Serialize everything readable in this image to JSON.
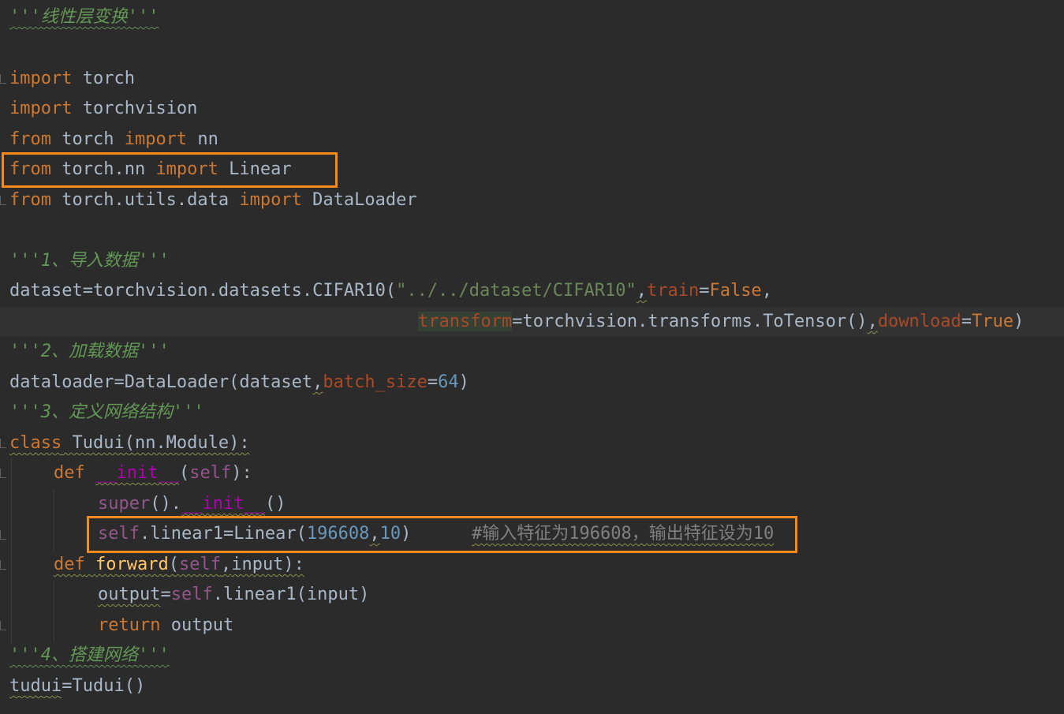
{
  "code": {
    "l1": {
      "doc": "'''线性层变换'''"
    },
    "l3": {
      "kw1": "import",
      "rest": " torch"
    },
    "l4": {
      "kw1": "import",
      "rest": " torchvision"
    },
    "l5": {
      "kw1": "from",
      "mid": " torch ",
      "kw2": "import",
      "rest": " nn"
    },
    "l6": {
      "kw1": "from",
      "mid": " torch.nn ",
      "kw2": "import",
      "rest": " Linear"
    },
    "l7": {
      "kw1": "from",
      "mid": " torch.utils.data ",
      "kw2": "import",
      "rest": " DataLoader"
    },
    "l9": {
      "doc": "'''1、导入数据'''"
    },
    "l10": {
      "a": "dataset",
      "b": "=torchvision.datasets.CIFAR10(",
      "s": "\"../../dataset/CIFAR10\"",
      "c": ",",
      "p": "train",
      "d": "=",
      "k": "False",
      "e": ","
    },
    "l11": {
      "p1": "transform",
      "a": "=torchvision.transforms.ToTensor()",
      "c": ",",
      "p2": "download",
      "d": "=",
      "k": "True",
      "e": ")"
    },
    "l12": {
      "doc": "'''2、加载数据'''"
    },
    "l13": {
      "a": "dataloader",
      "b": "=DataLoader(dataset",
      "c": ",",
      "p": "batch_size",
      "d": "=",
      "n": "64",
      "e": ")"
    },
    "l14": {
      "doc": "'''3、定义网络结构'''"
    },
    "l15": {
      "kw": "class",
      "rest": " Tudui(nn.Module):"
    },
    "l16": {
      "kw": "def",
      "sp": " ",
      "fn": "__init__",
      "a": "(",
      "self": "self",
      "b": "):"
    },
    "l17": {
      "sup": "super",
      "a": "().",
      "fn": "__init__",
      "b": "()"
    },
    "l18": {
      "self": "self",
      "a": ".linear1",
      "b": "=Linear(",
      "n1": "196608",
      "c": ",",
      "n2": "10",
      "d": ")",
      "cmt": "#输入特征为196608，输出特征设为10"
    },
    "l19": {
      "kw": "def",
      "sp": " ",
      "fn": "forward",
      "a": "(",
      "self": "self",
      "c": ",",
      "b": "input):"
    },
    "l20": {
      "a": "output",
      "b": "=",
      "self": "self",
      "c": ".linear1(input)"
    },
    "l21": {
      "kw": "return",
      "rest": " output"
    },
    "l22": {
      "doc": "'''4、搭建网络'''"
    },
    "l23": {
      "a": "tudui",
      "b": "=Tudui()"
    }
  },
  "colors": {
    "background": "#2b2b2b",
    "keyword": "#cc7832",
    "docstring": "#629755",
    "string": "#6a8759",
    "number": "#6897bb",
    "parameter": "#aa4926",
    "self": "#94558d",
    "dunder": "#b200b2",
    "function": "#ffc66d",
    "comment": "#808080",
    "default": "#a9b7c6",
    "highlight_box": "#f78a1d"
  }
}
